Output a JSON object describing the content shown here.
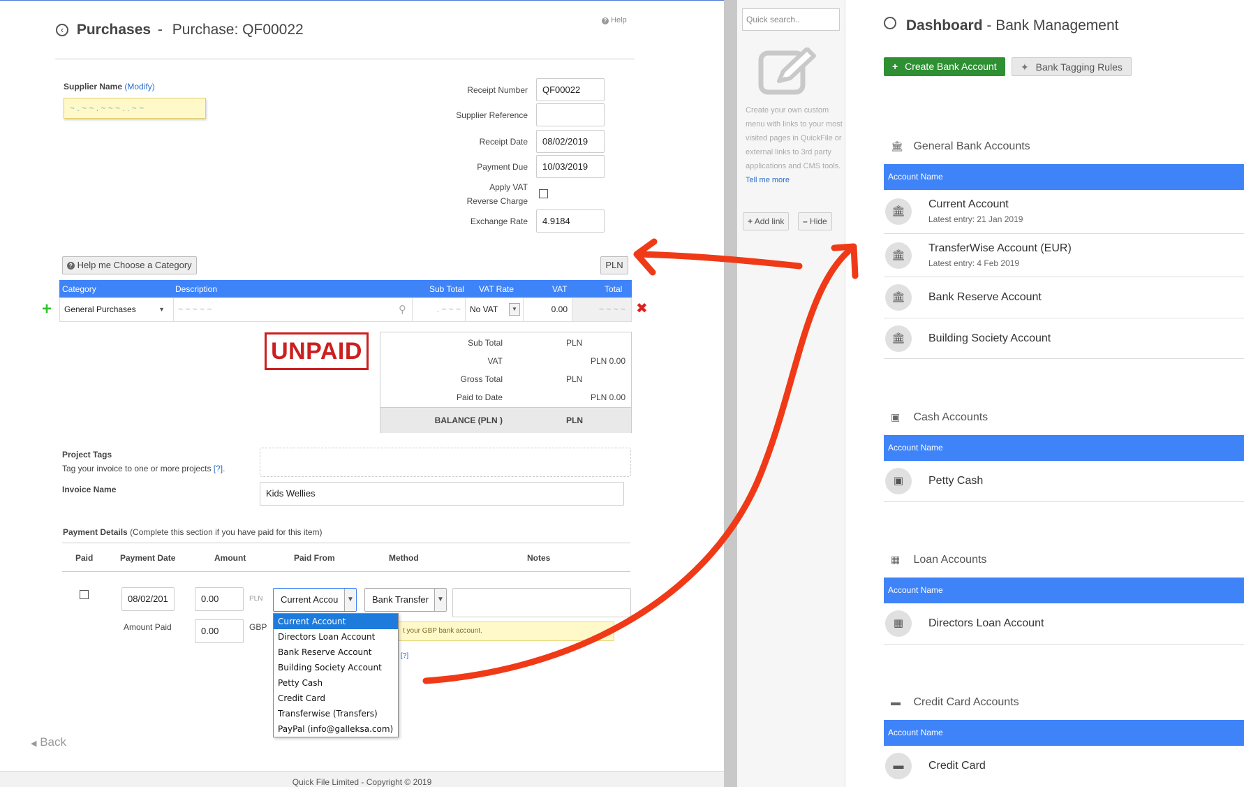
{
  "purchase": {
    "section": "Purchases",
    "sep": "-",
    "title": "Purchase: QF00022",
    "help": "Help",
    "supplier_label": "Supplier Name",
    "supplier_modify": "(Modify)",
    "fields": [
      {
        "label": "Receipt Number",
        "value": "QF00022"
      },
      {
        "label": "Supplier Reference",
        "value": ""
      },
      {
        "label": "Receipt Date",
        "value": "08/02/2019"
      },
      {
        "label": "Payment Due",
        "value": "10/03/2019"
      }
    ],
    "apply_vat_label": "Apply VAT",
    "reverse_charge_label": "Reverse Charge",
    "exchange_rate_label": "Exchange Rate",
    "exchange_rate_value": "4.9184",
    "help_category_button": "Help me Choose a Category",
    "currency_button": "PLN",
    "grid_headers": {
      "category": "Category",
      "description": "Description",
      "subtotal": "Sub Total",
      "vat_rate": "VAT Rate",
      "vat": "VAT",
      "total": "Total"
    },
    "line_item": {
      "category": "General Purchases",
      "vat_rate": "No VAT",
      "vat": "0.00"
    },
    "status_stamp": "UNPAID",
    "totals": [
      {
        "label": "Sub Total",
        "currency": "PLN",
        "value": ""
      },
      {
        "label": "VAT",
        "currency": "",
        "value": "PLN 0.00"
      },
      {
        "label": "Gross Total",
        "currency": "PLN",
        "value": ""
      },
      {
        "label": "Paid to Date",
        "currency": "",
        "value": "PLN 0.00"
      }
    ],
    "balance_label": "BALANCE (PLN )",
    "balance_currency": "PLN",
    "project_tags_label": "Project Tags",
    "project_tags_hint": "Tag your invoice to one or more projects",
    "project_tags_help": "[?].",
    "invoice_name_label": "Invoice Name",
    "invoice_name_value": "Kids Wellies",
    "payment_details_label": "Payment Details",
    "payment_details_hint": "(Complete this section if you have paid for this item)",
    "payment_columns": [
      "Paid",
      "Payment Date",
      "Amount",
      "Paid From",
      "Method",
      "Notes"
    ],
    "payment_date": "08/02/201",
    "amount": "0.00",
    "amount_currency": "PLN",
    "amount_paid_label": "Amount Paid",
    "amount_paid": "0.00",
    "amount_paid_currency": "GBP",
    "paid_from_value": "Current Accou",
    "method_value": "Bank Transfer",
    "paid_from_options": [
      "Current Account",
      "Directors Loan Account",
      "Bank Reserve Account",
      "Building Society Account",
      "Petty Cash",
      "Credit Card",
      "Transferwise (Transfers)",
      "PayPal (info@galleksa.com)"
    ],
    "warning_text": "t your GBP bank account.",
    "help_q": "[?]",
    "back": "Back",
    "footer": "Quick File Limited - Copyright © 2019"
  },
  "sidebar": {
    "search_placeholder": "Quick search..",
    "menu_text": "Create your own custom menu with links to your most visited pages in QuickFile or external links to 3rd party applications and CMS tools.",
    "tell_me_more": "Tell me more",
    "add_link": "Add link",
    "hide": "Hide"
  },
  "dashboard": {
    "section": "Dashboard",
    "sep": "-",
    "title": "Bank Management",
    "create_button": "Create Bank Account",
    "tagging_button": "Bank Tagging Rules",
    "column_header": "Account Name",
    "sections": [
      {
        "title": "General Bank Accounts",
        "icon": "bank-icon",
        "accounts": [
          {
            "name": "Current Account",
            "sub": "Latest entry: 21 Jan 2019"
          },
          {
            "name": "TransferWise Account (EUR)",
            "sub": "Latest entry: 4 Feb 2019"
          },
          {
            "name": "Bank Reserve Account",
            "sub": ""
          },
          {
            "name": "Building Society Account",
            "sub": ""
          }
        ]
      },
      {
        "title": "Cash Accounts",
        "icon": "cash-icon",
        "accounts": [
          {
            "name": "Petty Cash",
            "sub": ""
          }
        ]
      },
      {
        "title": "Loan Accounts",
        "icon": "calculator-icon",
        "accounts": [
          {
            "name": "Directors Loan Account",
            "sub": ""
          }
        ]
      },
      {
        "title": "Credit Card Accounts",
        "icon": "credit-card-icon",
        "accounts": [
          {
            "name": "Credit Card",
            "sub": ""
          }
        ]
      }
    ]
  },
  "colors": {
    "header_blue": "#3f83f8",
    "unpaid_red": "#cc1f1f",
    "create_green": "#2e8f33",
    "annotation_red": "#f03a17"
  }
}
